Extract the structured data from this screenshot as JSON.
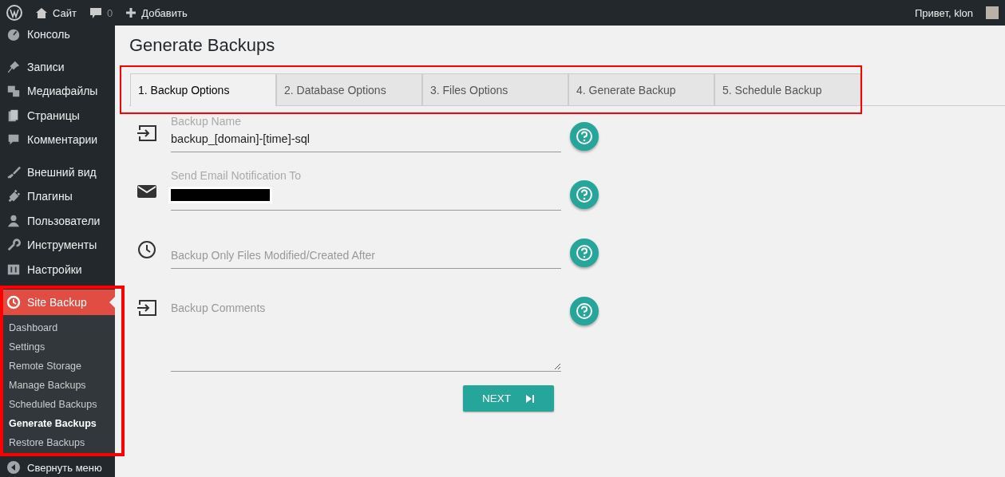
{
  "admin_bar": {
    "site": "Сайт",
    "comments": "0",
    "add_new": "Добавить",
    "greeting": "Привет, klon"
  },
  "sidebar": {
    "groups": [
      [
        {
          "label": "Консоль",
          "kind": "dashboard"
        }
      ],
      [
        {
          "label": "Записи",
          "kind": "pin"
        },
        {
          "label": "Медиафайлы",
          "kind": "media"
        },
        {
          "label": "Страницы",
          "kind": "pages"
        },
        {
          "label": "Комментарии",
          "kind": "comment"
        }
      ],
      [
        {
          "label": "Внешний вид",
          "kind": "brush"
        },
        {
          "label": "Плагины",
          "kind": "plugin"
        },
        {
          "label": "Пользователи",
          "kind": "user"
        },
        {
          "label": "Инструменты",
          "kind": "wrench"
        },
        {
          "label": "Настройки",
          "kind": "settings"
        }
      ]
    ],
    "active": {
      "label": "Site Backup",
      "submenu": [
        {
          "label": "Dashboard",
          "selected": false
        },
        {
          "label": "Settings",
          "selected": false
        },
        {
          "label": "Remote Storage",
          "selected": false
        },
        {
          "label": "Manage Backups",
          "selected": false
        },
        {
          "label": "Scheduled Backups",
          "selected": false
        },
        {
          "label": "Generate Backups",
          "selected": true
        },
        {
          "label": "Restore Backups",
          "selected": false
        }
      ]
    },
    "collapse": "Свернуть меню"
  },
  "page": {
    "title": "Generate Backups",
    "tabs": [
      {
        "label": "1. Backup Options",
        "selected": true
      },
      {
        "label": "2. Database Options",
        "selected": false
      },
      {
        "label": "3. Files Options",
        "selected": false
      },
      {
        "label": "4. Generate Backup",
        "selected": false
      },
      {
        "label": "5. Schedule Backup",
        "selected": false
      }
    ],
    "fields": [
      {
        "kind": "text",
        "label": "Backup Name",
        "value": "backup_[domain]-[time]-sql"
      },
      {
        "kind": "email",
        "label": "Send Email Notification To",
        "redacted": true
      },
      {
        "kind": "date",
        "placeholder": "Backup Only Files Modified/Created After"
      },
      {
        "kind": "textarea",
        "placeholder": "Backup Comments"
      }
    ],
    "next_button": "NEXT"
  }
}
